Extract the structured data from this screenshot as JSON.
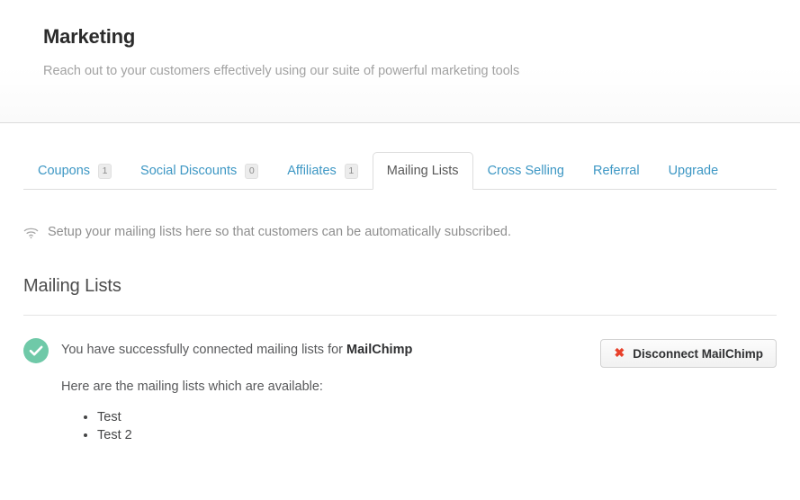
{
  "header": {
    "title": "Marketing",
    "subtitle": "Reach out to your customers effectively using our suite of powerful marketing tools"
  },
  "tabs": [
    {
      "label": "Coupons",
      "badge": "1",
      "active": false
    },
    {
      "label": "Social Discounts",
      "badge": "0",
      "active": false
    },
    {
      "label": "Affiliates",
      "badge": "1",
      "active": false
    },
    {
      "label": "Mailing Lists",
      "badge": null,
      "active": true
    },
    {
      "label": "Cross Selling",
      "badge": null,
      "active": false
    },
    {
      "label": "Referral",
      "badge": null,
      "active": false
    },
    {
      "label": "Upgrade",
      "badge": null,
      "active": false
    }
  ],
  "notice": {
    "icon": "wifi-icon",
    "text": "Setup your mailing lists here so that customers can be automatically subscribed."
  },
  "section": {
    "title": "Mailing Lists"
  },
  "status": {
    "icon": "check-circle-icon",
    "message_prefix": "You have successfully connected mailing lists for ",
    "provider": "MailChimp",
    "sub_message": "Here are the mailing lists which are available:",
    "lists": [
      "Test",
      "Test 2"
    ]
  },
  "disconnect_button": {
    "icon": "close-x-icon",
    "label": "Disconnect MailChimp"
  },
  "colors": {
    "tab_link": "#3d97c4",
    "tab_active_text": "#585858",
    "success_green": "#6fc9a8",
    "danger_red": "#e8402a",
    "title_dark": "#2b2b2b",
    "muted_gray": "#a2a2a2"
  }
}
